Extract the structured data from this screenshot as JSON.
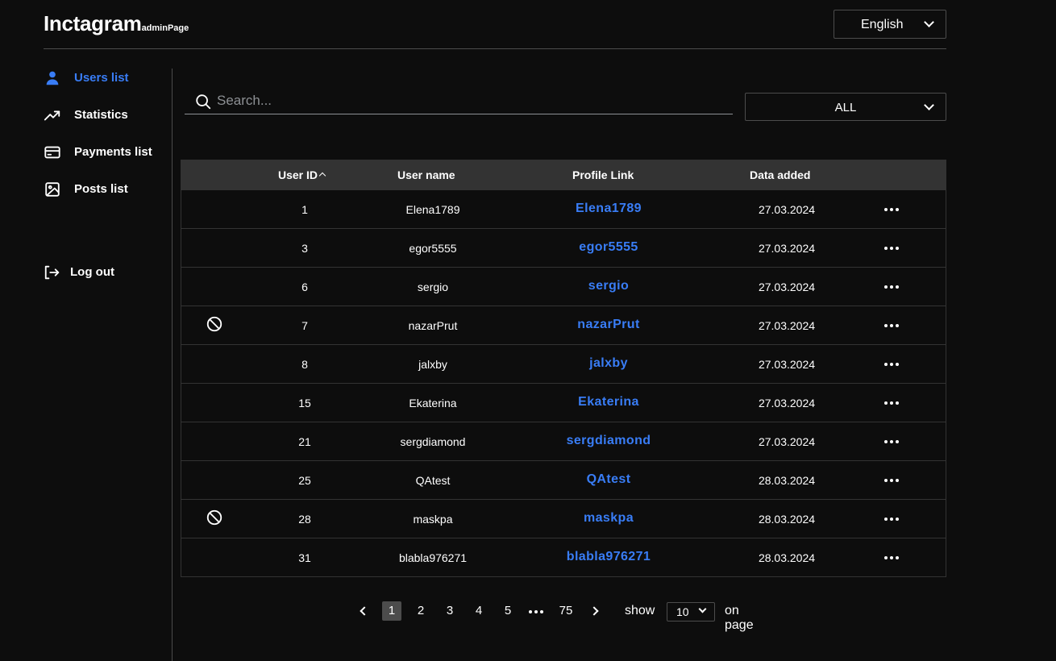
{
  "header": {
    "logo": "Inctagram",
    "logo_sub": "adminPage",
    "language": "English"
  },
  "sidebar": {
    "items": [
      {
        "label": "Users list",
        "icon": "person-icon",
        "active": true
      },
      {
        "label": "Statistics",
        "icon": "trending-up-icon",
        "active": false
      },
      {
        "label": "Payments list",
        "icon": "credit-card-icon",
        "active": false
      },
      {
        "label": "Posts list",
        "icon": "image-icon",
        "active": false
      }
    ],
    "logout": "Log out"
  },
  "search": {
    "placeholder": "Search...",
    "value": ""
  },
  "filter": {
    "value": "ALL"
  },
  "table": {
    "headers": {
      "user_id": "User ID",
      "user_name": "User name",
      "profile_link": "Profile Link",
      "date_added": "Data added"
    },
    "rows": [
      {
        "banned": false,
        "id": "1",
        "name": "Elena1789",
        "link": "Elena1789",
        "date": "27.03.2024"
      },
      {
        "banned": false,
        "id": "3",
        "name": "egor5555",
        "link": "egor5555",
        "date": "27.03.2024"
      },
      {
        "banned": false,
        "id": "6",
        "name": "sergio",
        "link": "sergio",
        "date": "27.03.2024"
      },
      {
        "banned": true,
        "id": "7",
        "name": "nazarPrut",
        "link": "nazarPrut",
        "date": "27.03.2024"
      },
      {
        "banned": false,
        "id": "8",
        "name": "jalxby",
        "link": "jalxby",
        "date": "27.03.2024"
      },
      {
        "banned": false,
        "id": "15",
        "name": "Ekaterina",
        "link": "Ekaterina",
        "date": "27.03.2024"
      },
      {
        "banned": false,
        "id": "21",
        "name": "sergdiamond",
        "link": "sergdiamond",
        "date": "27.03.2024"
      },
      {
        "banned": false,
        "id": "25",
        "name": "QAtest",
        "link": "QAtest",
        "date": "28.03.2024"
      },
      {
        "banned": true,
        "id": "28",
        "name": "maskpa",
        "link": "maskpa",
        "date": "28.03.2024"
      },
      {
        "banned": false,
        "id": "31",
        "name": "blabla976271",
        "link": "blabla976271",
        "date": "28.03.2024"
      }
    ]
  },
  "pagination": {
    "pages": [
      "1",
      "2",
      "3",
      "4",
      "5"
    ],
    "current": "1",
    "last": "75",
    "show_label": "show",
    "per_page": "10",
    "on_page_label": "on page"
  },
  "colors": {
    "accent": "#397df6",
    "background": "#0d0d0d",
    "header_row": "#333333",
    "border": "#4c4c4c"
  }
}
